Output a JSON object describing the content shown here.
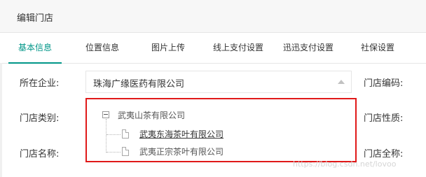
{
  "dialog": {
    "title": "编辑门店"
  },
  "tabs": [
    {
      "label": "基本信息",
      "active": true
    },
    {
      "label": "位置信息",
      "active": false
    },
    {
      "label": "图片上传",
      "active": false
    },
    {
      "label": "线上支付设置",
      "active": false
    },
    {
      "label": "迅迅支付设置",
      "active": false
    },
    {
      "label": "社保设置",
      "active": false
    }
  ],
  "form": {
    "company_label": "所在企业:",
    "company_value": "珠海广缘医药有限公司",
    "store_code_label": "门店编码:",
    "store_type_label": "门店类别:",
    "store_nature_label": "门店性质:",
    "store_name_label": "门店名称:",
    "store_fullname_label": "门店全称:"
  },
  "tree": {
    "root": "武夷山茶有限公司",
    "children": [
      "武夷东海茶叶有限公司",
      "武夷正宗茶叶有限公司"
    ]
  },
  "watermark": "https://blog.csdn.net/lovoo",
  "colors": {
    "accent": "#009688",
    "highlight_border": "#e01919"
  },
  "icons": {
    "collapse": "minus-square-icon",
    "file": "file-icon",
    "dropdown": "caret-up-icon"
  }
}
